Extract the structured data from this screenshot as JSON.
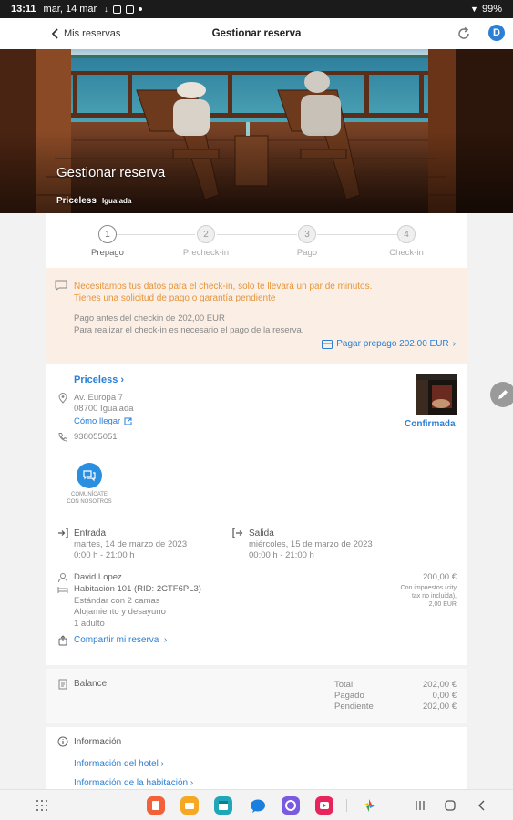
{
  "status_bar": {
    "time": "13:11",
    "date": "mar, 14 mar",
    "battery": "99%"
  },
  "app_bar": {
    "back_label": "Mis reservas",
    "title": "Gestionar reserva",
    "avatar_letter": "D"
  },
  "hero": {
    "title": "Gestionar reserva",
    "hotel": "Priceless",
    "city": "Igualada"
  },
  "steps": [
    {
      "num": "1",
      "label": "Prepago",
      "active": true
    },
    {
      "num": "2",
      "label": "Precheck-in",
      "active": false
    },
    {
      "num": "3",
      "label": "Pago",
      "active": false
    },
    {
      "num": "4",
      "label": "Check-in",
      "active": false
    }
  ],
  "notice": {
    "warn_1": "Necesitamos tus datos para el check-in, solo te llevará un par de minutos.",
    "warn_2": "Tienes una solicitud de pago o garantía pendiente",
    "info_1": "Pago antes del checkin de 202,00 EUR",
    "info_2": "Para realizar el check-in es necesario el pago de la reserva.",
    "pay_link": "Pagar prepago 202,00 EUR"
  },
  "hotel": {
    "name": "Priceless",
    "address_1": "Av. Europa 7",
    "address_2": "08700 Igualada",
    "directions": "Cómo llegar",
    "phone": "938055051",
    "status": "Confirmada",
    "contact_1": "COMUNÍCATE",
    "contact_2": "CON NOSOTROS"
  },
  "stay": {
    "checkin_label": "Entrada",
    "checkin_date": "martes, 14 de marzo de 2023",
    "checkin_time": "0:00 h - 21:00 h",
    "checkout_label": "Salida",
    "checkout_date": "miércoles, 15 de marzo de 2023",
    "checkout_time": "00:00 h - 21:00 h"
  },
  "guest": {
    "name": "David Lopez",
    "room": "Habitación 101 (RID: 2CTF6PL3)",
    "room_type": "Estándar con 2 camas",
    "board": "Alojamiento y desayuno",
    "occupancy": "1 adulto",
    "price": "200,00 €",
    "tax_1": "Con impuestos (city",
    "tax_2": "tax no incluida),",
    "tax_3": "2,00 EUR",
    "share": "Compartir mi reserva"
  },
  "balance": {
    "label": "Balance",
    "total_label": "Total",
    "total": "202,00 €",
    "paid_label": "Pagado",
    "paid": "0,00 €",
    "pending_label": "Pendiente",
    "pending": "202,00 €"
  },
  "information": {
    "label": "Información",
    "hotel_info": "Información del hotel",
    "room_info": "Información de la habitación"
  },
  "colors": {
    "accent": "#2a7fd4",
    "warning": "#e6953a",
    "notice_bg": "#fbeee4"
  }
}
